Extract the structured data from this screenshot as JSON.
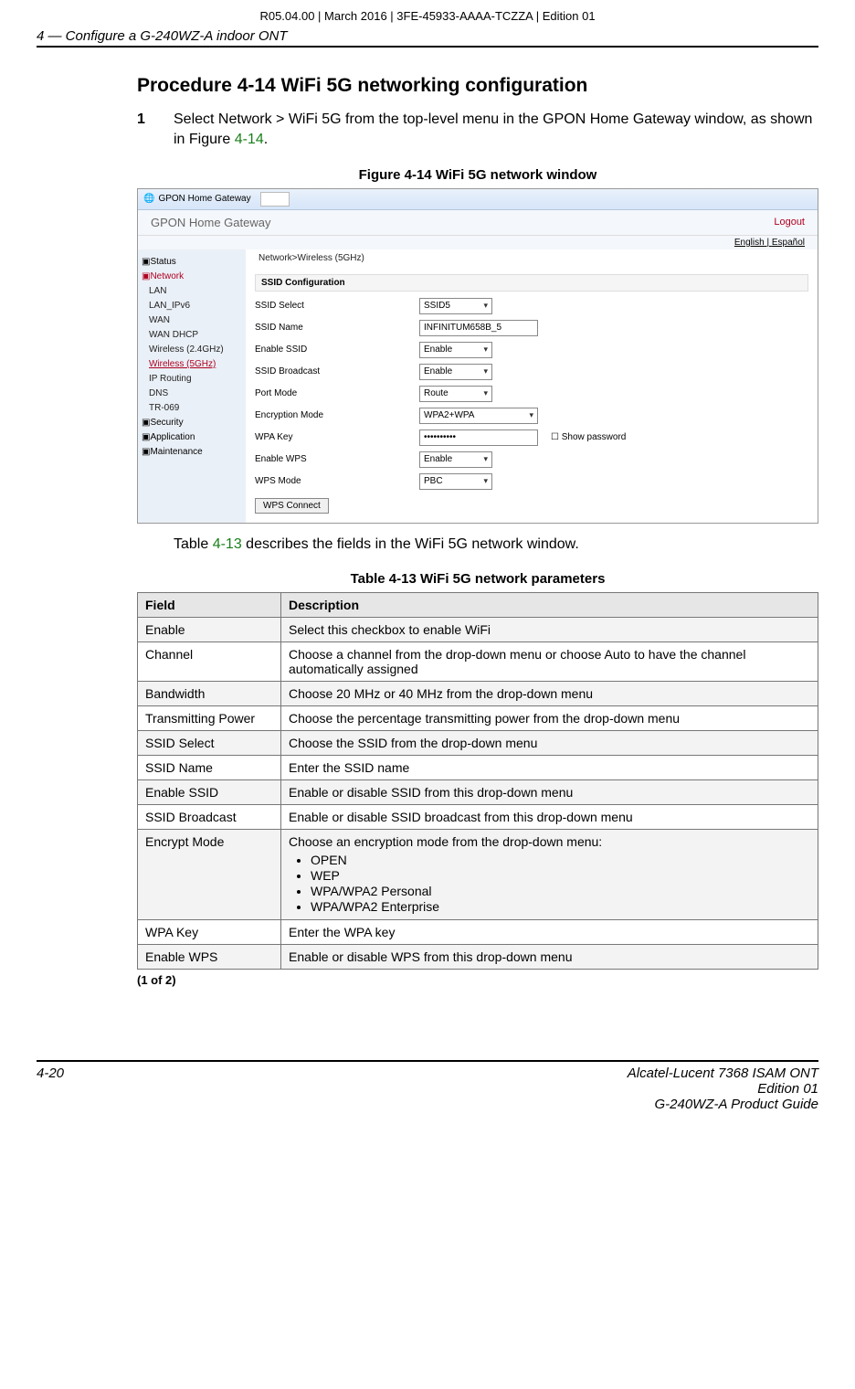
{
  "doc": {
    "meta": "R05.04.00 | March 2016 | 3FE-45933-AAAA-TCZZA | Edition 01",
    "running_head": "4 —  Configure a G-240WZ-A indoor ONT",
    "procedure_title": "Procedure 4-14  WiFi 5G networking configuration",
    "step1_num": "1",
    "step1_a": "Select Network > WiFi 5G from the top-level menu in the GPON Home Gateway window, as shown in Figure ",
    "step1_ref": "4-14",
    "step1_b": ".",
    "figure_caption": "Figure 4-14  WiFi 5G network window",
    "post_fig_a": "Table ",
    "post_fig_ref": "4-13",
    "post_fig_b": " describes the fields in the WiFi 5G network window.",
    "table_caption": "Table 4-13 WiFi 5G network parameters",
    "table_foot": "(1 of 2)",
    "footer_left": "4-20",
    "footer_right_1": "Alcatel-Lucent 7368 ISAM ONT",
    "footer_right_2": "Edition 01",
    "footer_right_3": "G-240WZ-A Product Guide"
  },
  "screenshot": {
    "tab_title": "GPON Home Gateway",
    "brand": "GPON Home Gateway",
    "logout": "Logout",
    "lang_en": "English",
    "lang_sep": " | ",
    "lang_es": "Español",
    "crumb": "Network>Wireless (5GHz)",
    "section": "SSID Configuration",
    "sidebar": {
      "status": "Status",
      "network": "Network",
      "lan": "LAN",
      "lan_ipv6": "LAN_IPv6",
      "wan": "WAN",
      "wan_dhcp": "WAN DHCP",
      "w24": "Wireless (2.4GHz)",
      "w5": "Wireless (5GHz)",
      "ip_routing": "IP Routing",
      "dns": "DNS",
      "tr069": "TR-069",
      "security": "Security",
      "application": "Application",
      "maintenance": "Maintenance"
    },
    "rows": {
      "ssid_select_lbl": "SSID Select",
      "ssid_select_val": "SSID5",
      "ssid_name_lbl": "SSID Name",
      "ssid_name_val": "INFINITUM658B_5",
      "enable_ssid_lbl": "Enable SSID",
      "enable_ssid_val": "Enable",
      "ssid_bcast_lbl": "SSID Broadcast",
      "ssid_bcast_val": "Enable",
      "port_mode_lbl": "Port Mode",
      "port_mode_val": "Route",
      "enc_mode_lbl": "Encryption Mode",
      "enc_mode_val": "WPA2+WPA",
      "wpa_key_lbl": "WPA Key",
      "wpa_key_val": "••••••••••",
      "show_pw": "Show password",
      "enable_wps_lbl": "Enable WPS",
      "enable_wps_val": "Enable",
      "wps_mode_lbl": "WPS Mode",
      "wps_mode_val": "PBC",
      "wps_btn": "WPS Connect"
    }
  },
  "table": {
    "head_field": "Field",
    "head_desc": "Description",
    "rows": [
      {
        "field": "Enable",
        "desc": "Select this checkbox to enable WiFi"
      },
      {
        "field": "Channel",
        "desc": "Choose a channel from the drop-down menu or choose Auto to have the channel automatically assigned"
      },
      {
        "field": "Bandwidth",
        "desc": "Choose 20 MHz or 40 MHz from the drop-down menu"
      },
      {
        "field": "Transmitting Power",
        "desc": "Choose the percentage transmitting power from the drop-down menu"
      },
      {
        "field": "SSID Select",
        "desc": "Choose the SSID from the drop-down menu"
      },
      {
        "field": "SSID Name",
        "desc": "Enter the SSID name"
      },
      {
        "field": "Enable SSID",
        "desc": "Enable or disable SSID from this drop-down menu"
      },
      {
        "field": "SSID Broadcast",
        "desc": "Enable or disable SSID broadcast from this drop-down menu"
      },
      {
        "field": "Encrypt Mode",
        "desc_intro": "Choose an encryption mode from the drop-down menu:",
        "list": [
          "OPEN",
          "WEP",
          "WPA/WPA2 Personal",
          "WPA/WPA2 Enterprise"
        ]
      },
      {
        "field": "WPA Key",
        "desc": "Enter the WPA key"
      },
      {
        "field": "Enable WPS",
        "desc": "Enable or disable WPS from this drop-down menu"
      }
    ]
  }
}
